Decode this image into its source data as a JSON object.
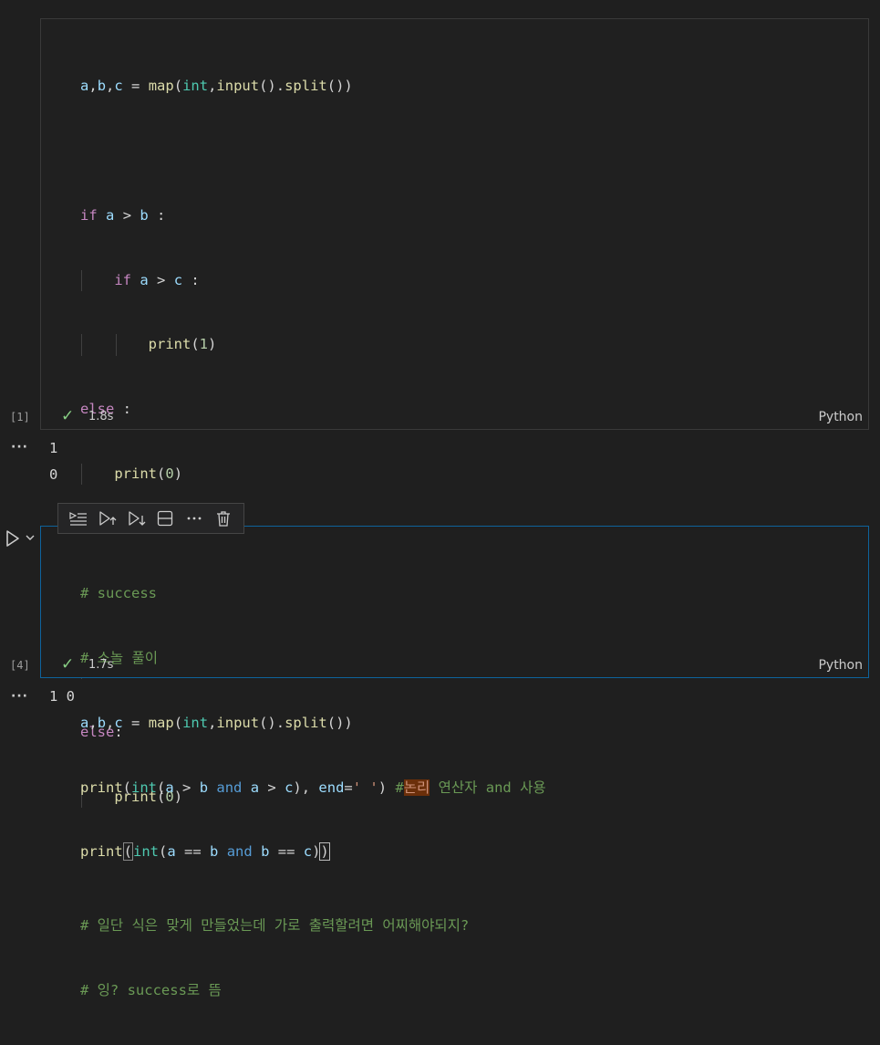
{
  "cell1": {
    "exec_count": "[1]",
    "duration": "1.8s",
    "language": "Python",
    "comment1": "# 일단 식은 맞게 만들었는데 가로 출력할려면 어찌해야되지?",
    "comment2": "# 잉? success로 뜸",
    "output_lines": [
      "1",
      "0"
    ]
  },
  "cell2": {
    "exec_count": "[4]",
    "duration": "1.7s",
    "language": "Python",
    "comment1": "# success",
    "comment2": "# 소놀 풀이",
    "inline_comment_hl": "논리",
    "inline_comment_rest": " 연산자 and 사용",
    "output": "1 0"
  },
  "output_prefix": "···",
  "toolbar": {
    "items": [
      "execute-above-icon",
      "run-above-icon",
      "run-below-icon",
      "split-cell-icon",
      "more-icon",
      "delete-icon"
    ]
  },
  "colors": {
    "accent": "#0e639c",
    "check": "#89d185",
    "comment": "#6a9955",
    "keyword": "#c586c0"
  }
}
